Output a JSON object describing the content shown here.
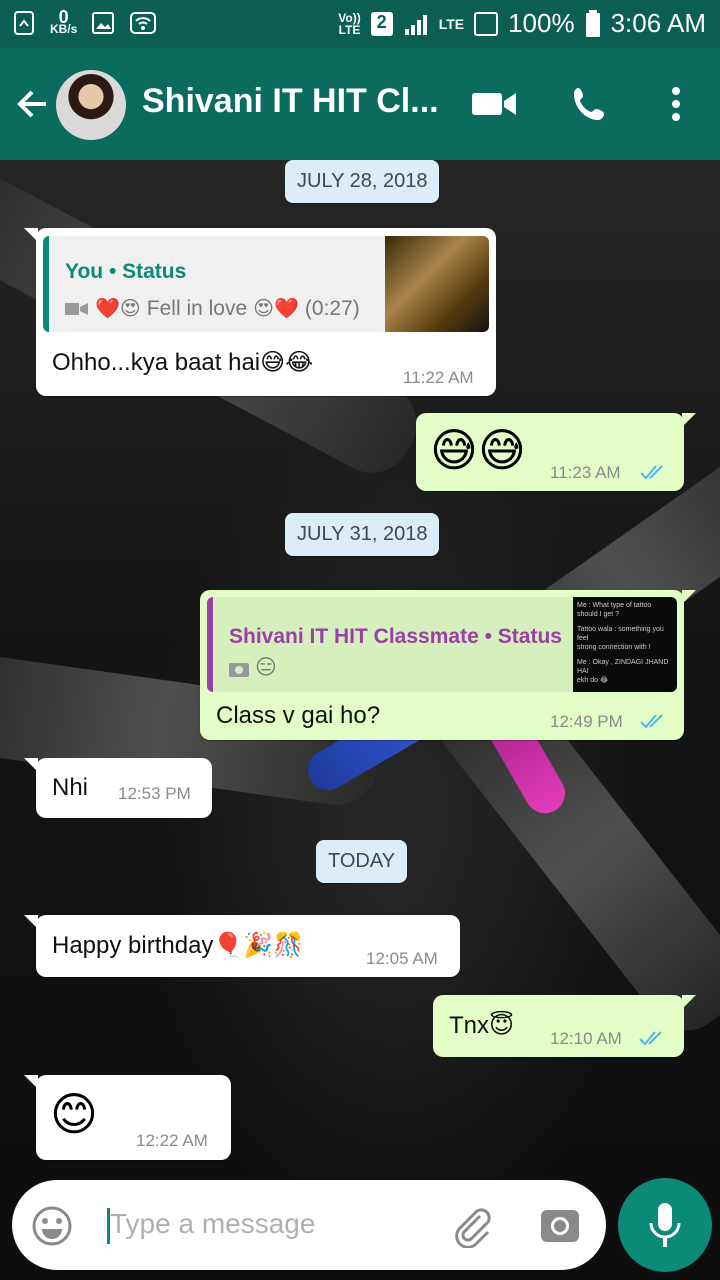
{
  "status_bar": {
    "net_speed_value": "0",
    "net_speed_unit": "KB/s",
    "volte": "Vo))",
    "lte1": "LTE",
    "sim": "2",
    "lte2": "LTE",
    "battery": "100%",
    "time": "3:06 AM"
  },
  "header": {
    "contact_name": "Shivani IT HIT Cl...",
    "colors": {
      "statusbar": "#0a5e52",
      "appbar": "#0a6b5e"
    }
  },
  "messages": {
    "date1": "JULY 28, 2018",
    "m1": {
      "reply_author": "You • Status",
      "reply_text": "Fell in love",
      "reply_duration": "(0:27)",
      "text": "Ohho...kya baat hai😅😂",
      "time": "11:22 AM"
    },
    "m2": {
      "text": "😅😅",
      "time": "11:23 AM"
    },
    "date2": "JULY 31, 2018",
    "m3": {
      "reply_author": "Shivani IT HIT Classmate • Status",
      "reply_text": "😑",
      "thumb_lines": [
        "Me : What type of tattoo",
        "should I get ?",
        "Tattoo wala : something you feel",
        "strong connection with !",
        "Me : Okay , ZINDAGI JHAND HAI",
        "ekh do 😂"
      ],
      "text": "Class v gai ho?",
      "time": "12:49 PM"
    },
    "m4": {
      "text": "Nhi",
      "time": "12:53 PM"
    },
    "date3": "TODAY",
    "m5": {
      "text": "Happy birthday🎈🎉🎊",
      "time": "12:05 AM"
    },
    "m6": {
      "text": "Tnx😇",
      "time": "12:10 AM"
    },
    "m7": {
      "text": "😊",
      "time": "12:22 AM"
    }
  },
  "input": {
    "placeholder": "Type a message"
  },
  "colors": {
    "accent": "#0a8a77",
    "read_ticks": "#4fb6ec",
    "incoming_bubble": "#ffffff",
    "outgoing_bubble": "#e2fdc6"
  }
}
